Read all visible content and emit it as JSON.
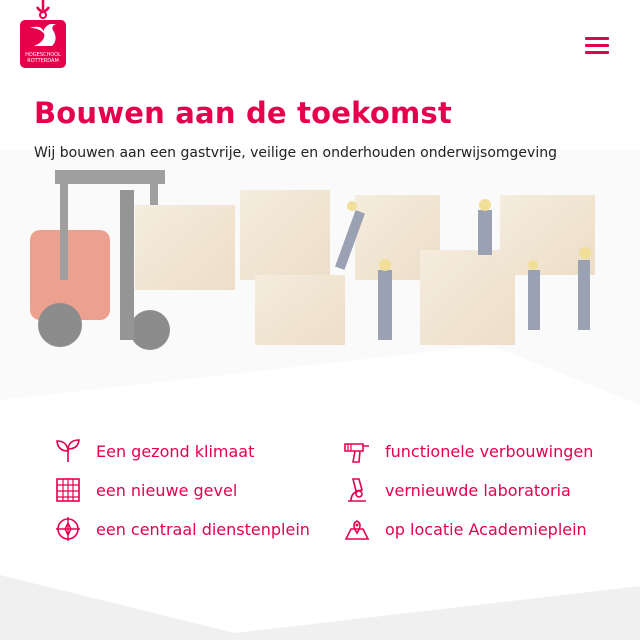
{
  "logo": {
    "line1": "HOGESCHOOL",
    "line2": "ROTTERDAM"
  },
  "menu": {
    "icon": "hamburger-menu-icon"
  },
  "hero": {
    "title": "Bouwen aan de toekomst",
    "subtitle": "Wij bouwen aan een gastvrije, veilige en onderhouden onderwijsomgeving"
  },
  "features": [
    {
      "icon": "sprout-icon",
      "label": "Een gezond klimaat"
    },
    {
      "icon": "building-icon",
      "label": "een nieuwe gevel"
    },
    {
      "icon": "compass-icon",
      "label": "een centraal dienstenplein"
    },
    {
      "icon": "drill-icon",
      "label": "functionele verbouwingen"
    },
    {
      "icon": "microscope-icon",
      "label": "vernieuwde laboratoria"
    },
    {
      "icon": "location-pin-icon",
      "label": "op locatie Academieplein"
    }
  ],
  "colors": {
    "brand": "#e6004c",
    "text": "#222222",
    "wave": "#f0f0f1"
  }
}
